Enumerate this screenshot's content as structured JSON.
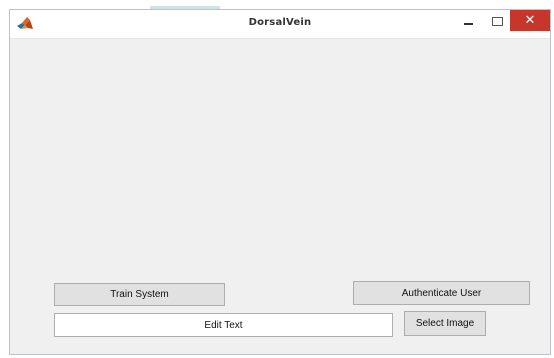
{
  "window": {
    "title": "DorsalVein",
    "app_icon": "matlab-logo-icon",
    "controls": {
      "minimize_icon": "minimize-icon",
      "maximize_icon": "maximize-icon",
      "close_glyph": "✕"
    }
  },
  "buttons": {
    "train": "Train System",
    "authenticate": "Authenticate User",
    "select_image": "Select Image"
  },
  "edit_text": {
    "value": "Edit Text"
  },
  "colors": {
    "close_button": "#c7362b",
    "window_background": "#f0f0f0",
    "button_face": "#e1e1e1"
  }
}
